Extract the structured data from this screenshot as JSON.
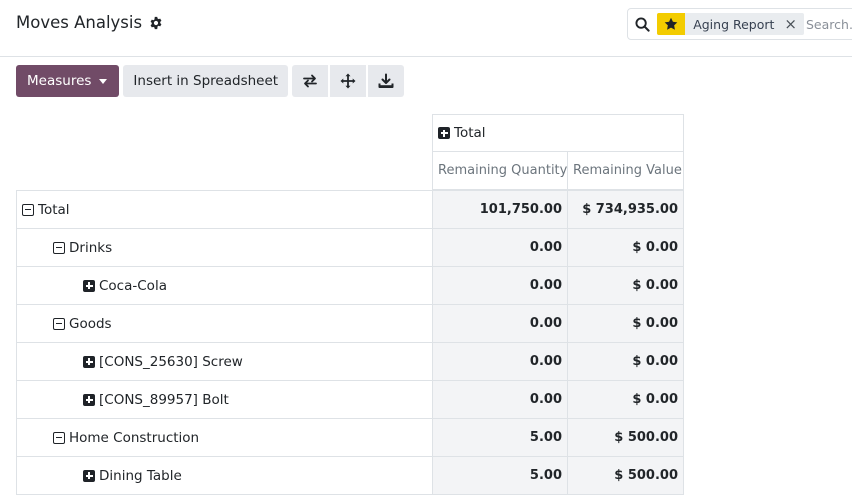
{
  "header": {
    "title": "Moves Analysis",
    "settings_icon": "gear-icon"
  },
  "search": {
    "icon": "search-icon",
    "facet_icon": "star-icon",
    "facet_label": "Aging Report",
    "facet_remove": "×",
    "placeholder": "Search..."
  },
  "toolbar": {
    "measures_label": "Measures",
    "insert_label": "Insert in Spreadsheet",
    "icons": [
      "flip-axis-icon",
      "expand-all-icon",
      "download-icon"
    ]
  },
  "pivot": {
    "column_header": "Total",
    "measures": [
      "Remaining Quantity",
      "Remaining Value"
    ],
    "rows": [
      {
        "label": "Total",
        "expanded": true,
        "level": 0,
        "quantity": "101,750.00",
        "value": "$ 734,935.00"
      },
      {
        "label": "Drinks",
        "expanded": true,
        "level": 1,
        "quantity": "0.00",
        "value": "$ 0.00"
      },
      {
        "label": "Coca-Cola",
        "expanded": false,
        "level": 2,
        "quantity": "0.00",
        "value": "$ 0.00"
      },
      {
        "label": "Goods",
        "expanded": true,
        "level": 1,
        "quantity": "0.00",
        "value": "$ 0.00"
      },
      {
        "label": "[CONS_25630] Screw",
        "expanded": false,
        "level": 2,
        "quantity": "0.00",
        "value": "$ 0.00"
      },
      {
        "label": "[CONS_89957] Bolt",
        "expanded": false,
        "level": 2,
        "quantity": "0.00",
        "value": "$ 0.00"
      },
      {
        "label": "Home Construction",
        "expanded": true,
        "level": 1,
        "quantity": "5.00",
        "value": "$ 500.00"
      },
      {
        "label": "Dining Table",
        "expanded": false,
        "level": 2,
        "quantity": "5.00",
        "value": "$ 500.00"
      }
    ]
  },
  "colors": {
    "primary": "#714B67",
    "facet_accent": "#F3CC00",
    "border": "#DEE2E6",
    "cell_background": "#F3F4F6"
  }
}
